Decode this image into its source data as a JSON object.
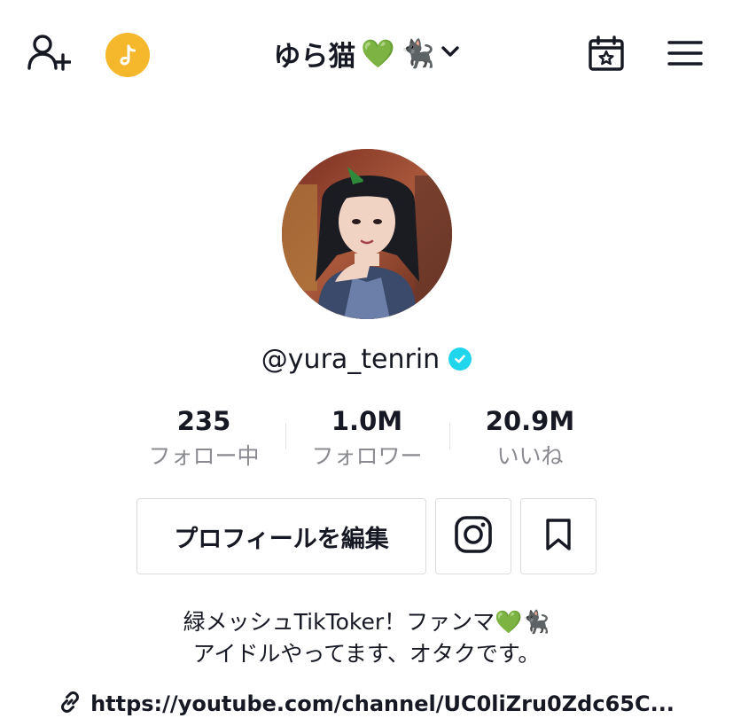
{
  "header": {
    "title": "ゆら猫",
    "title_emoji_heart": "💚",
    "title_emoji_cat": "🐈‍⬛",
    "add_user_icon": "add-user-icon",
    "coin_icon": "tiktok-coin-icon",
    "calendar_icon": "calendar-star-icon",
    "menu_icon": "hamburger-menu-icon"
  },
  "profile": {
    "username": "@yura_tenrin",
    "verified": true
  },
  "stats": [
    {
      "value": "235",
      "label": "フォロー中"
    },
    {
      "value": "1.0M",
      "label": "フォロワー"
    },
    {
      "value": "20.9M",
      "label": "いいね"
    }
  ],
  "actions": {
    "edit_profile_label": "プロフィールを編集",
    "instagram_icon": "instagram-icon",
    "bookmark_icon": "bookmark-icon"
  },
  "bio": {
    "line1": "緑メッシュTikToker！ファンマ💚🐈‍⬛",
    "line2": "アイドルやってます、オタクです。"
  },
  "link": {
    "url": "https://youtube.com/channel/UC0liZru0Zdc65C..."
  },
  "colors": {
    "text": "#161823",
    "secondary": "#8a8b91",
    "verified": "#20d5ec",
    "coin": "#f5b72c",
    "heart": "#3cc43c"
  }
}
